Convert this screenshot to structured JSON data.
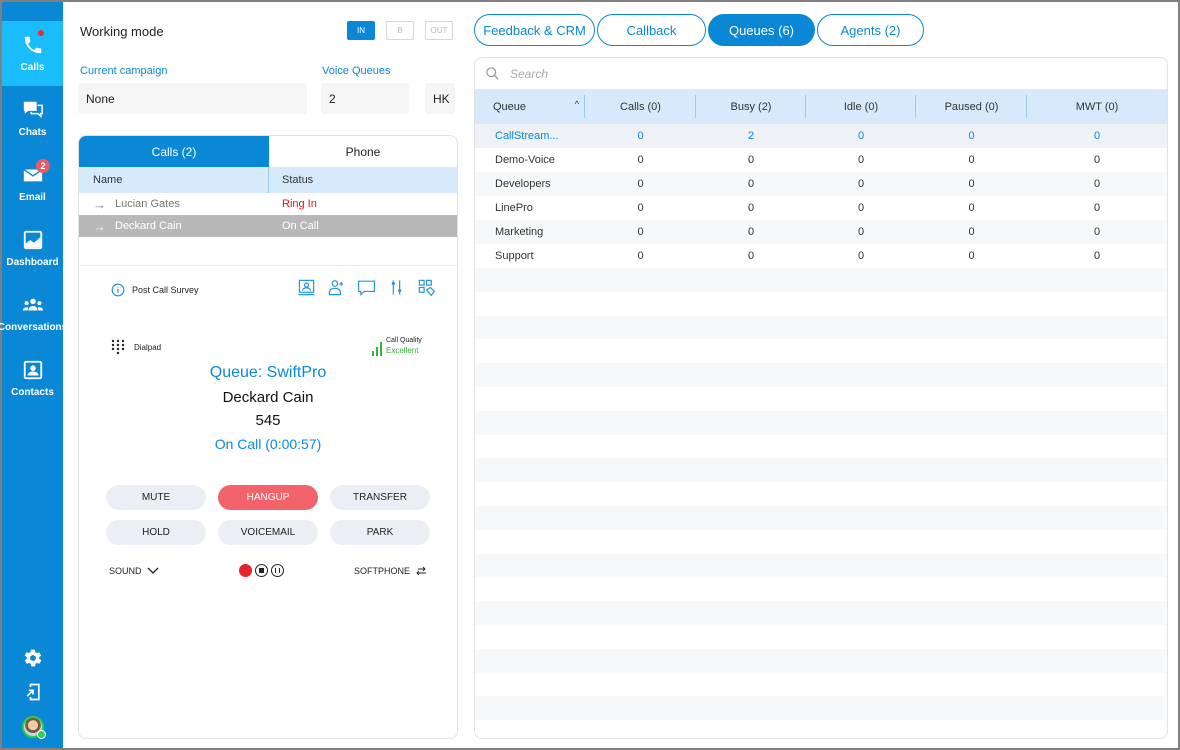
{
  "sidebar": {
    "items": [
      {
        "label": "Calls",
        "icon": "phone-icon",
        "active": true,
        "dot": true
      },
      {
        "label": "Chats",
        "icon": "chat-icon"
      },
      {
        "label": "Email",
        "icon": "email-icon",
        "badge": "2"
      },
      {
        "label": "Dashboard",
        "icon": "dashboard-icon"
      },
      {
        "label": "Conversations",
        "icon": "conversations-icon"
      },
      {
        "label": "Contacts",
        "icon": "contacts-icon"
      }
    ],
    "bottom_icons": [
      "gear-icon",
      "logout-icon",
      "avatar"
    ]
  },
  "working_mode": {
    "label": "Working mode",
    "buttons": [
      {
        "label": "IN",
        "active": true
      },
      {
        "label": "B",
        "active": false
      },
      {
        "label": "OUT",
        "active": false
      }
    ]
  },
  "campaign": {
    "label": "Current campaign",
    "value": "None"
  },
  "voice_queues": {
    "label": "Voice Queues",
    "value": "2",
    "extra": "HK"
  },
  "calls_panel": {
    "tabs": [
      {
        "label": "Calls (2)",
        "active": true
      },
      {
        "label": "Phone",
        "active": false
      }
    ],
    "columns": [
      "Name",
      "Status"
    ],
    "rows": [
      {
        "name": "Lucian Gates",
        "status": "Ring In",
        "selected": false
      },
      {
        "name": "Deckard Cain",
        "status": "On Call",
        "selected": true
      }
    ]
  },
  "call_detail": {
    "survey_label": "Post Call Survey",
    "dialpad_label": "Dialpad",
    "quality_label": "Call Quality",
    "quality_value": "Excellent",
    "queue": "Queue: SwiftPro",
    "caller": "Deckard Cain",
    "number": "545",
    "status": "On Call (0:00:57)",
    "actions": [
      "MUTE",
      "HANGUP",
      "TRANSFER",
      "HOLD",
      "VOICEMAIL",
      "PARK"
    ],
    "sound_label": "SOUND",
    "softphone_label": "SOFTPHONE",
    "colors": {
      "accent": "#0a88d6",
      "danger": "#f2636b",
      "quality": "#35b23a",
      "ring": "#e0101a"
    }
  },
  "right_tabs": [
    {
      "label": "Feedback & CRM",
      "active": false
    },
    {
      "label": "Callback",
      "active": false
    },
    {
      "label": "Queues (6)",
      "active": true
    },
    {
      "label": "Agents (2)",
      "active": false
    }
  ],
  "queues": {
    "search_placeholder": "Search",
    "columns": [
      "Queue",
      "Calls (0)",
      "Busy (2)",
      "Idle (0)",
      "Paused (0)",
      "MWT (0)"
    ],
    "rows": [
      [
        "CallStream...",
        "0",
        "2",
        "0",
        "0",
        "0"
      ],
      [
        "Demo-Voice",
        "0",
        "0",
        "0",
        "0",
        "0"
      ],
      [
        "Developers",
        "0",
        "0",
        "0",
        "0",
        "0"
      ],
      [
        "LinePro",
        "0",
        "0",
        "0",
        "0",
        "0"
      ],
      [
        "Marketing",
        "0",
        "0",
        "0",
        "0",
        "0"
      ],
      [
        "Support",
        "0",
        "0",
        "0",
        "0",
        "0"
      ]
    ]
  }
}
